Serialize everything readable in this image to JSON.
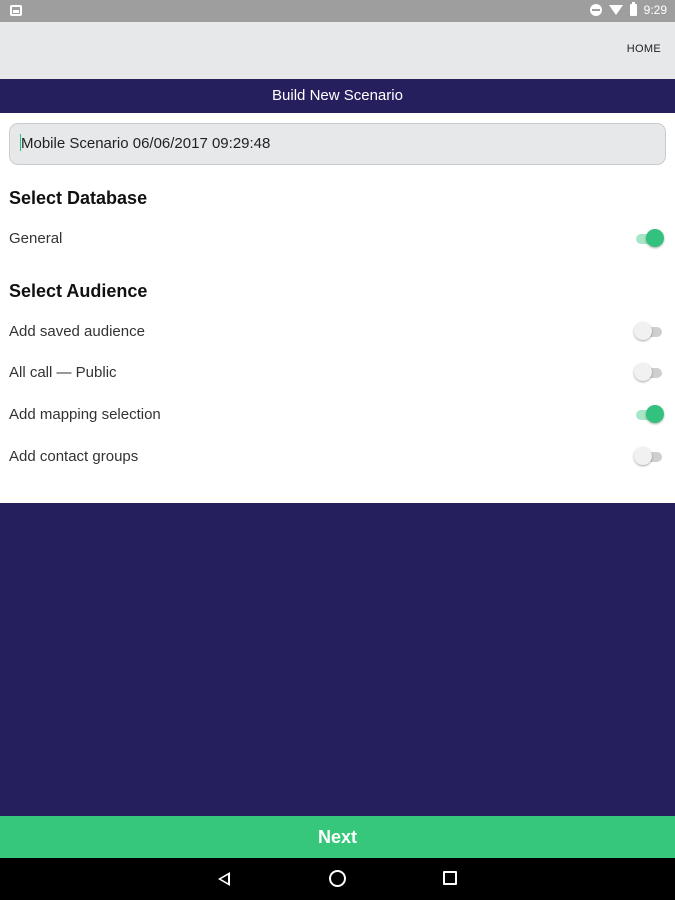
{
  "status_bar": {
    "time": "9:29",
    "icons": [
      "notification-icon",
      "dnd-icon",
      "wifi-icon",
      "battery-icon"
    ]
  },
  "app_bar": {
    "home_label": "HOME"
  },
  "title_bar": {
    "title": "Build New Scenario"
  },
  "scenario_name": {
    "value": "Mobile Scenario 06/06/2017 09:29:48"
  },
  "select_database": {
    "heading": "Select Database",
    "items": [
      {
        "label": "General",
        "enabled": true
      }
    ]
  },
  "select_audience": {
    "heading": "Select Audience",
    "items": [
      {
        "label": "Add saved audience",
        "enabled": false
      },
      {
        "label": "All call — Public",
        "enabled": false
      },
      {
        "label": "Add mapping selection",
        "enabled": true
      },
      {
        "label": "Add contact groups",
        "enabled": false
      }
    ]
  },
  "footer": {
    "next_label": "Next"
  },
  "nav_bar": {
    "icons": [
      "back-icon",
      "home-icon",
      "recents-icon"
    ]
  },
  "colors": {
    "primary": "#261f5e",
    "accent": "#36c77b",
    "toggle_on": "#33c27d",
    "app_bar_bg": "#e6e8ea"
  }
}
